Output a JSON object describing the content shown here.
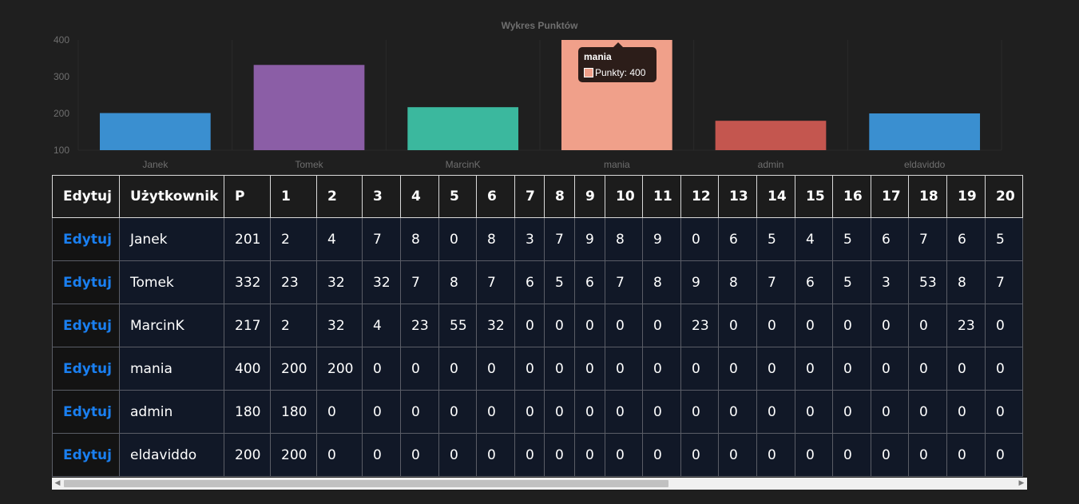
{
  "chart_data": {
    "type": "bar",
    "title": "Wykres Punktów",
    "categories": [
      "Janek",
      "Tomek",
      "MarcinK",
      "mania",
      "admin",
      "eldaviddo"
    ],
    "series": [
      {
        "name": "Punkty",
        "values": [
          201,
          332,
          217,
          400,
          180,
          200
        ]
      }
    ],
    "colors": [
      "#3a8fd0",
      "#8b5ea6",
      "#3bb89e",
      "#f0a08a",
      "#c4564f",
      "#3a8fd0"
    ],
    "ylim": [
      100,
      400
    ],
    "yticks": [
      "400",
      "300",
      "200",
      "100"
    ],
    "grid": true,
    "legend": "none"
  },
  "tooltip": {
    "title": "mania",
    "text": "Punkty: 400",
    "swatch_color": "#f0a08a"
  },
  "table": {
    "headers": [
      "Edytuj",
      "Użytkownik",
      "P",
      "1",
      "2",
      "3",
      "4",
      "5",
      "6",
      "7",
      "8",
      "9",
      "10",
      "11",
      "12",
      "13",
      "14",
      "15",
      "16",
      "17",
      "18",
      "19",
      "20"
    ],
    "edit_label": "Edytuj",
    "rows": [
      [
        "Janek",
        "201",
        "2",
        "4",
        "7",
        "8",
        "0",
        "8",
        "3",
        "7",
        "9",
        "8",
        "9",
        "0",
        "6",
        "5",
        "4",
        "5",
        "6",
        "7",
        "6",
        "5"
      ],
      [
        "Tomek",
        "332",
        "23",
        "32",
        "32",
        "7",
        "8",
        "7",
        "6",
        "5",
        "6",
        "7",
        "8",
        "9",
        "8",
        "7",
        "6",
        "5",
        "3",
        "53",
        "8",
        "7"
      ],
      [
        "MarcinK",
        "217",
        "2",
        "32",
        "4",
        "23",
        "55",
        "32",
        "0",
        "0",
        "0",
        "0",
        "0",
        "23",
        "0",
        "0",
        "0",
        "0",
        "0",
        "0",
        "23",
        "0"
      ],
      [
        "mania",
        "400",
        "200",
        "200",
        "0",
        "0",
        "0",
        "0",
        "0",
        "0",
        "0",
        "0",
        "0",
        "0",
        "0",
        "0",
        "0",
        "0",
        "0",
        "0",
        "0",
        "0"
      ],
      [
        "admin",
        "180",
        "180",
        "0",
        "0",
        "0",
        "0",
        "0",
        "0",
        "0",
        "0",
        "0",
        "0",
        "0",
        "0",
        "0",
        "0",
        "0",
        "0",
        "0",
        "0",
        "0"
      ],
      [
        "eldaviddo",
        "200",
        "200",
        "0",
        "0",
        "0",
        "0",
        "0",
        "0",
        "0",
        "0",
        "0",
        "0",
        "0",
        "0",
        "0",
        "0",
        "0",
        "0",
        "0",
        "0",
        "0"
      ]
    ]
  },
  "colors": {
    "background": "#1f1f1f",
    "edit_link": "#1a7ff0",
    "row_background": "#111827"
  }
}
